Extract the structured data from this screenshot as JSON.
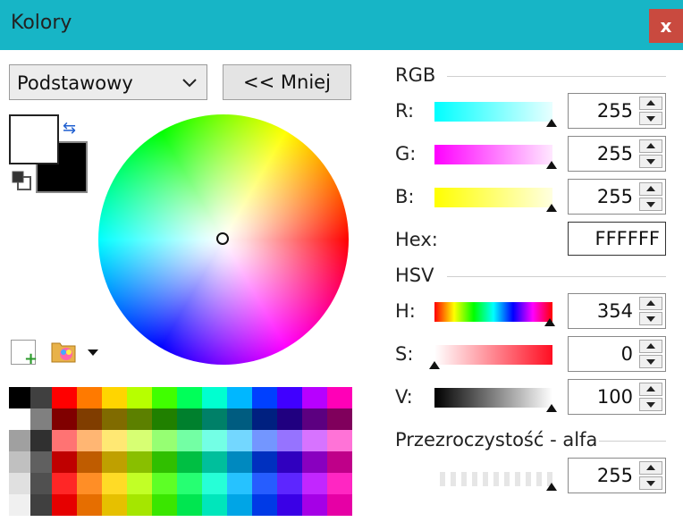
{
  "window": {
    "title": "Kolory",
    "close_label": "x"
  },
  "palette_select": {
    "value": "Podstawowy"
  },
  "less_button": {
    "label": "<< Mniej"
  },
  "rgb": {
    "section": "RGB",
    "r": {
      "label": "R:",
      "value": "255"
    },
    "g": {
      "label": "G:",
      "value": "255"
    },
    "b": {
      "label": "B:",
      "value": "255"
    }
  },
  "hex": {
    "label": "Hex:",
    "value": "FFFFFF"
  },
  "hsv": {
    "section": "HSV",
    "h": {
      "label": "H:",
      "value": "354"
    },
    "s": {
      "label": "S:",
      "value": "0"
    },
    "v": {
      "label": "V:",
      "value": "100"
    }
  },
  "alpha": {
    "section": "Przezroczystość - alfa",
    "value": "255"
  },
  "colors": {
    "primary": "#ffffff",
    "secondary": "#000000",
    "titlebar": "#17b5c6"
  },
  "icons": [
    "swap-colors-icon",
    "reset-colors-icon",
    "add-color-icon",
    "palette-folder-icon",
    "chevron-down-icon"
  ]
}
